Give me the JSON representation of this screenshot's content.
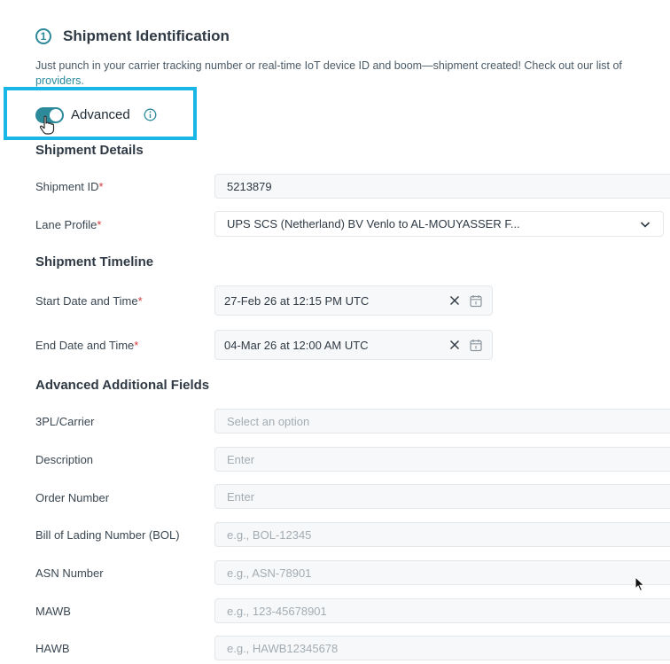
{
  "section": {
    "step_number": "1",
    "title": "Shipment Identification",
    "subtitle_main": "Just punch in your carrier tracking number or real-time IoT device ID and boom—shipment created! Check out our list of",
    "subtitle_link": "providers."
  },
  "advanced": {
    "label": "Advanced",
    "enabled": true
  },
  "shipment_details": {
    "heading": "Shipment Details",
    "shipment_id_label": "Shipment ID",
    "shipment_id_value": "5213879",
    "lane_profile_label": "Lane Profile",
    "lane_profile_value": "UPS SCS (Netherland) BV Venlo to AL-MOUYASSER F..."
  },
  "timeline": {
    "heading": "Shipment Timeline",
    "start_label": "Start Date and Time",
    "start_value": "27-Feb 26 at 12:15 PM UTC",
    "end_label": "End Date and Time",
    "end_value": "04-Mar 26 at 12:00 AM UTC"
  },
  "additional": {
    "heading": "Advanced Additional Fields",
    "fields": [
      {
        "label": "3PL/Carrier",
        "placeholder": "Select an option"
      },
      {
        "label": "Description",
        "placeholder": "Enter"
      },
      {
        "label": "Order Number",
        "placeholder": "Enter"
      },
      {
        "label": "Bill of Lading Number (BOL)",
        "placeholder": "e.g., BOL-12345"
      },
      {
        "label": "ASN Number",
        "placeholder": "e.g., ASN-78901"
      },
      {
        "label": "MAWB",
        "placeholder": "e.g., 123-45678901"
      },
      {
        "label": "HAWB",
        "placeholder": "e.g., HAWB12345678"
      }
    ]
  },
  "required_marker": "*",
  "colors": {
    "accent": "#2c8a9a",
    "highlight": "#19b6e8",
    "required": "#d63b3b"
  }
}
